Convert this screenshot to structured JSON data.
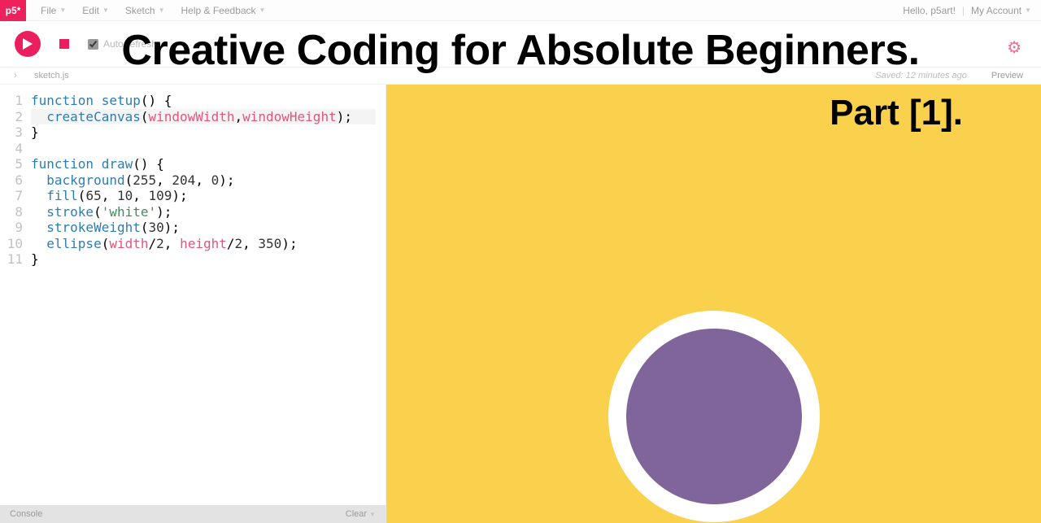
{
  "logo": "p5*",
  "menu": {
    "items": [
      "File",
      "Edit",
      "Sketch",
      "Help & Feedback"
    ],
    "greeting": "Hello, p5art!",
    "account": "My Account"
  },
  "toolbar": {
    "autorefresh_label": "Auto-refresh"
  },
  "tabs": {
    "filename": "sketch.js",
    "save_status": "Saved: 12 minutes ago",
    "preview_label": "Preview"
  },
  "code": {
    "lines": [
      {
        "n": 1,
        "raw": "function setup() {"
      },
      {
        "n": 2,
        "raw": "  createCanvas(windowWidth,windowHeight);",
        "hl": true
      },
      {
        "n": 3,
        "raw": "}"
      },
      {
        "n": 4,
        "raw": ""
      },
      {
        "n": 5,
        "raw": "function draw() {"
      },
      {
        "n": 6,
        "raw": "  background(255, 204, 0);"
      },
      {
        "n": 7,
        "raw": "  fill(65, 10, 109);"
      },
      {
        "n": 8,
        "raw": "  stroke('white');"
      },
      {
        "n": 9,
        "raw": "  strokeWeight(30);"
      },
      {
        "n": 10,
        "raw": "  ellipse(width/2, height/2, 350);"
      },
      {
        "n": 11,
        "raw": "}"
      }
    ]
  },
  "console": {
    "label": "Console",
    "clear": "Clear"
  },
  "overlay": {
    "title": "Creative Coding for Absolute Beginners.",
    "part": "Part [1]."
  },
  "preview_canvas": {
    "bg": "#f9d14c",
    "circle_fill": "#7f659a",
    "circle_stroke": "#ffffff",
    "stroke_weight": 30,
    "diameter": 350
  }
}
